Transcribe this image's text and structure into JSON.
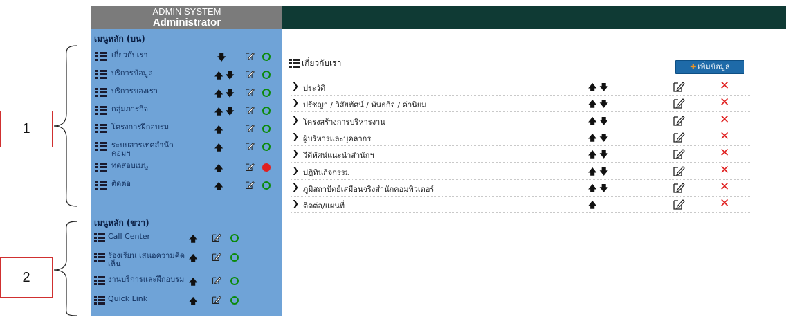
{
  "header": {
    "system": "ADMIN SYSTEM",
    "role": "Administrator"
  },
  "sidebar": {
    "top_title": "เมนูหลัก (บน)",
    "top_items": [
      {
        "label": "เกี่ยวกับเรา",
        "up": false,
        "down": true,
        "status": "active"
      },
      {
        "label": "บริการข้อมูล",
        "up": true,
        "down": true,
        "status": "active"
      },
      {
        "label": "บริการของเรา",
        "up": true,
        "down": true,
        "status": "active"
      },
      {
        "label": "กลุ่มภารกิจ",
        "up": true,
        "down": true,
        "status": "active"
      },
      {
        "label": "โครงการฝึกอบรม",
        "up": true,
        "down": false,
        "status": "active"
      },
      {
        "label": "ระบบสารเทศสำนัก คอมฯ",
        "up": true,
        "down": false,
        "status": "active"
      },
      {
        "label": "ทดสอบเมนู",
        "up": true,
        "down": false,
        "status": "inactive"
      },
      {
        "label": "ติดต่อ",
        "up": true,
        "down": false,
        "status": "active"
      }
    ],
    "right_title": "เมนูหลัก (ขวา)",
    "right_items": [
      {
        "label": "Call Center",
        "status": "active"
      },
      {
        "label": "ร้องเรียน เสนอความคิดเห็น",
        "status": "active"
      },
      {
        "label": "งานบริการและฝึกอบรม",
        "status": "active"
      },
      {
        "label": "Quick Link",
        "status": "active"
      }
    ]
  },
  "main": {
    "title": "เกี่ยวกับเรา",
    "add_button": "เพิ่มข้อมูล",
    "rows": [
      {
        "label": "ประวัติ",
        "up": true,
        "down": true
      },
      {
        "label": "ปรัชญา / วิสัยทัศน์ / พันธกิจ / ค่านิยม",
        "up": true,
        "down": true
      },
      {
        "label": "โครงสร้างการบริหารงาน",
        "up": true,
        "down": true
      },
      {
        "label": "ผู้บริหารและบุคลากร",
        "up": true,
        "down": true
      },
      {
        "label": "วีดีทัศน์แนะนำสำนักฯ",
        "up": true,
        "down": true
      },
      {
        "label": "ปฏิทินกิจกรรม",
        "up": true,
        "down": true
      },
      {
        "label": "ภูมิสถาปัตย์เสมือนจริงสำนักคอมพิวเตอร์",
        "up": true,
        "down": true
      },
      {
        "label": "ติดต่อ/แผนที่",
        "up": true,
        "down": false
      }
    ]
  },
  "annotations": {
    "box1": "1",
    "box2": "2"
  },
  "colors": {
    "header_dark": "#0f3a34",
    "sidebar": "#6fa3d7",
    "header_grey": "#7b7b7b",
    "active": "#0b8a0b",
    "inactive": "#e02020",
    "delete": "#e02020"
  },
  "icons": {
    "list": "list-icon",
    "edit": "edit-icon",
    "up": "arrow-up-icon",
    "down": "arrow-down-icon",
    "delete": "delete-icon",
    "chevron": "chevron-right-icon"
  }
}
